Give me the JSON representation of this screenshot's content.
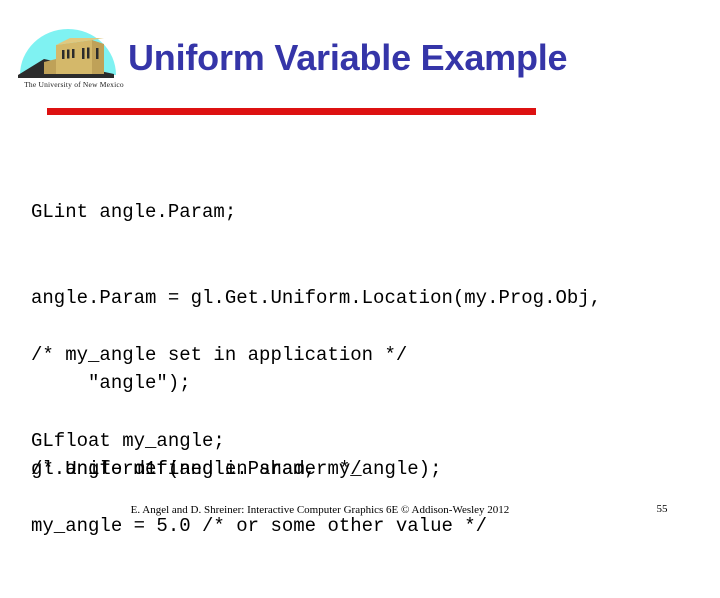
{
  "slide": {
    "title": "Uniform Variable Example",
    "accent_color": "#3535a8",
    "rule_color": "#dd1111",
    "background_color": "#ffffff"
  },
  "logo": {
    "name": "unm-logo",
    "caption": "The University of New Mexico",
    "dome_color": "#7FF2F2",
    "building_color": "#D4B86A",
    "building_shade_color": "#A88F4A",
    "shadow_color": "#2B2B2B",
    "window_color": "#2B2B2B"
  },
  "code": {
    "block1": [
      "GLint angle.Param;",
      "angle.Param = gl.Get.Uniform.Location(my.Prog.Obj,",
      "     \"angle\");",
      "/* angle defined in shader */"
    ],
    "block2": [
      "/* my_angle set in application */",
      "GLfloat my_angle;",
      "my_angle = 5.0 /* or some other value */"
    ],
    "block3": [
      "gl.Uniform1f(angle.Param, my_angle);"
    ]
  },
  "footer": {
    "citation": "E. Angel and D. Shreiner: Interactive Computer Graphics 6E © Addison-Wesley 2012",
    "page_number": "55"
  }
}
